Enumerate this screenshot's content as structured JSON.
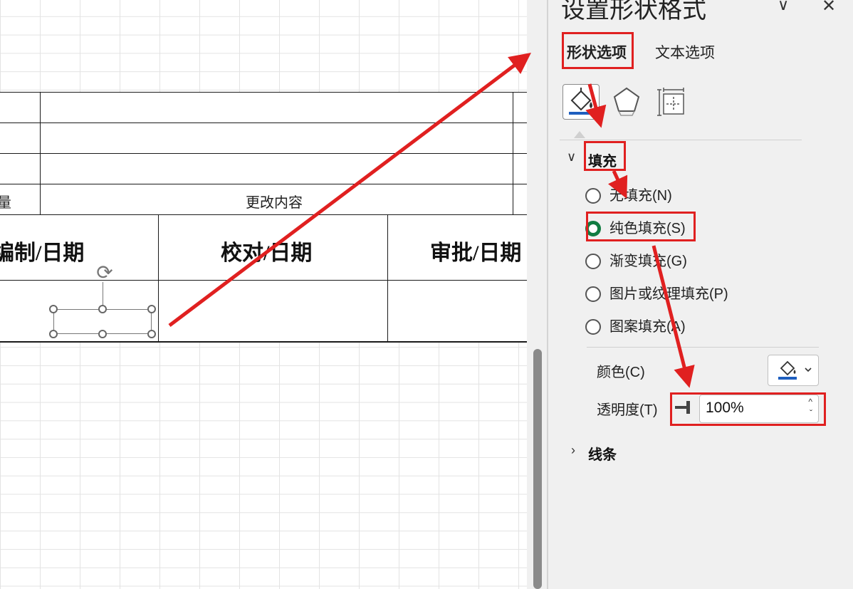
{
  "sheet": {
    "table": {
      "row4_left": "量",
      "row4_right": "更改内容",
      "headers": [
        "编制/日期",
        "校对/日期",
        "审批/日期"
      ]
    }
  },
  "pane": {
    "title": "设置形状格式",
    "tabs": [
      {
        "label": "形状选项",
        "selected": true
      },
      {
        "label": "文本选项",
        "selected": false
      }
    ],
    "icon_tabs": [
      "paint-bucket-icon",
      "pentagon-icon",
      "size-properties-icon"
    ],
    "fill_section": {
      "label": "填充",
      "expanded": true,
      "options": [
        {
          "label": "无填充(N)",
          "selected": false
        },
        {
          "label": "纯色填充(S)",
          "selected": true
        },
        {
          "label": "渐变填充(G)",
          "selected": false
        },
        {
          "label": "图片或纹理填充(P)",
          "selected": false
        },
        {
          "label": "图案填充(A)",
          "selected": false
        }
      ],
      "color_label": "颜色(C)",
      "transparency_label": "透明度(T)",
      "transparency_value": "100%"
    },
    "line_section": {
      "label": "线条",
      "expanded": false
    }
  },
  "colors": {
    "accent_green": "#107c41",
    "tab_underline": "#217346",
    "annotation_red": "#e02020",
    "fill_swatch": "#1f5fbf"
  }
}
